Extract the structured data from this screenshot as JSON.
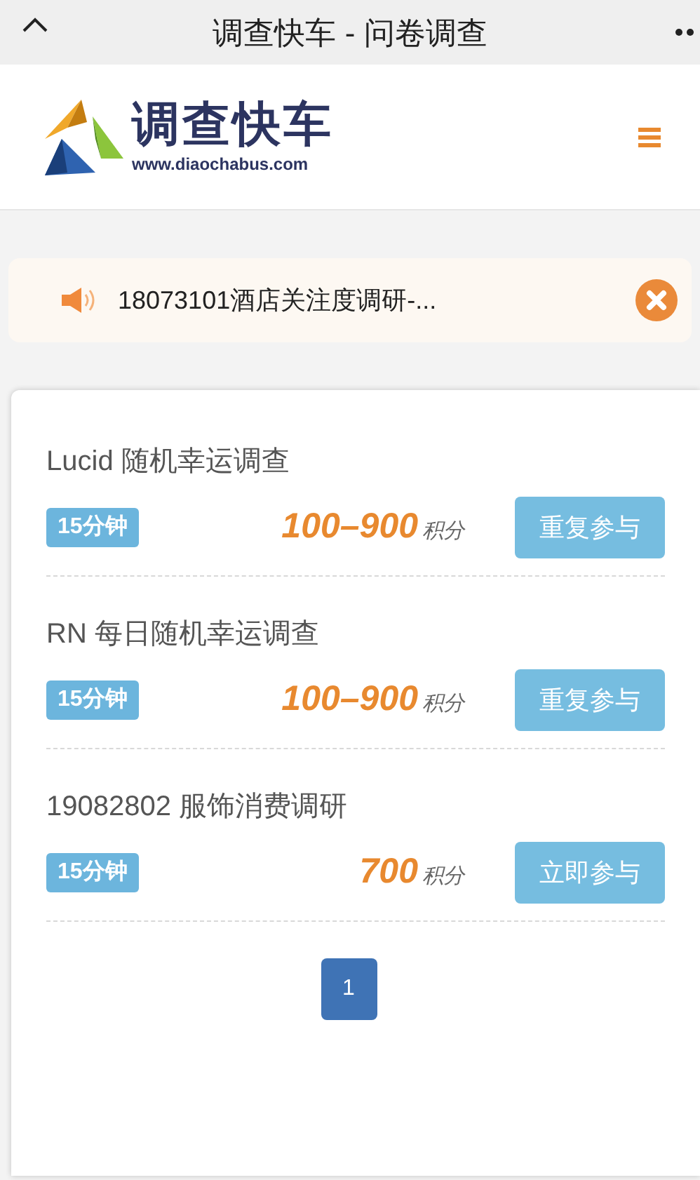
{
  "nav_bar": {
    "title": "调查快车 - 问卷调查"
  },
  "header": {
    "logo_name": "调查快车",
    "logo_url": "www.diaochabus.com"
  },
  "notice": {
    "text": "18073101酒店关注度调研-..."
  },
  "surveys": [
    {
      "title": "Lucid 随机幸运调查",
      "duration": "15分钟",
      "points": "100–900",
      "points_unit": "积分",
      "action": "重复参与"
    },
    {
      "title": "RN 每日随机幸运调查",
      "duration": "15分钟",
      "points": "100–900",
      "points_unit": "积分",
      "action": "重复参与"
    },
    {
      "title": "19082802 服饰消费调研",
      "duration": "15分钟",
      "points": "700",
      "points_unit": "积分",
      "action": "立即参与"
    }
  ],
  "pagination": [
    {
      "label": "1",
      "selected": true
    }
  ]
}
